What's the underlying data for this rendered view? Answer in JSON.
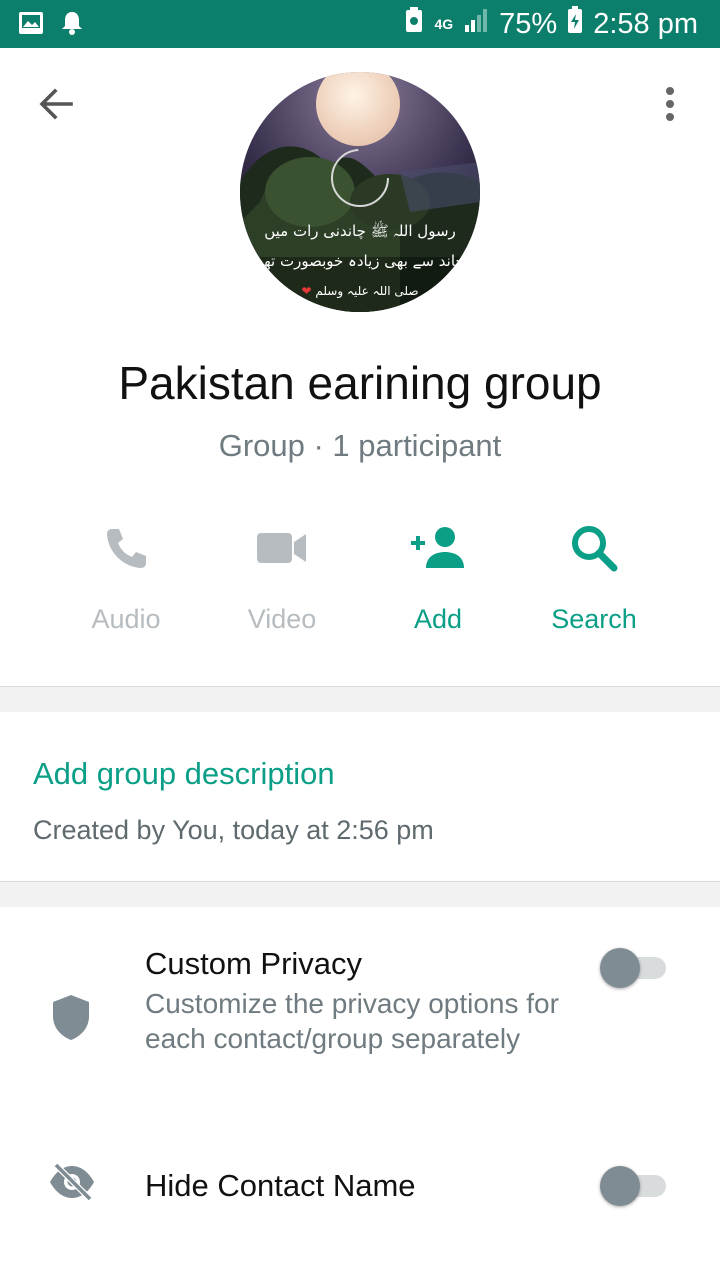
{
  "status_bar": {
    "network": "4G",
    "battery": "75%",
    "time": "2:58 pm"
  },
  "colors": {
    "status_bar": "#0b7f6b",
    "accent": "#0a9f86",
    "disabled": "#b6bcbf",
    "secondary_text": "#6f7b80"
  },
  "avatar": {
    "caption_line1": "رسول اللہ ﷺ چاندنی رات میں",
    "caption_line2": "چاند سے بھی زیادہ خوبصورت تھے",
    "caption_line3": "صلی اللہ علیہ وسلم"
  },
  "group": {
    "name": "Pakistan earining group",
    "subtitle": "Group · 1 participant"
  },
  "actions": [
    {
      "label": "Audio",
      "icon": "phone-icon",
      "enabled": false
    },
    {
      "label": "Video",
      "icon": "video-camera-icon",
      "enabled": false
    },
    {
      "label": "Add",
      "icon": "add-person-icon",
      "enabled": true
    },
    {
      "label": "Search",
      "icon": "search-icon",
      "enabled": true
    }
  ],
  "description": {
    "link_label": "Add group description",
    "created_text": "Created by You, today at 2:56 pm"
  },
  "settings": [
    {
      "title": "Custom Privacy",
      "description": "Customize the privacy options for each contact/group separately",
      "icon": "shield-icon",
      "enabled": false
    },
    {
      "title": "Hide Contact Name",
      "icon": "eye-off-icon",
      "enabled": false
    }
  ]
}
